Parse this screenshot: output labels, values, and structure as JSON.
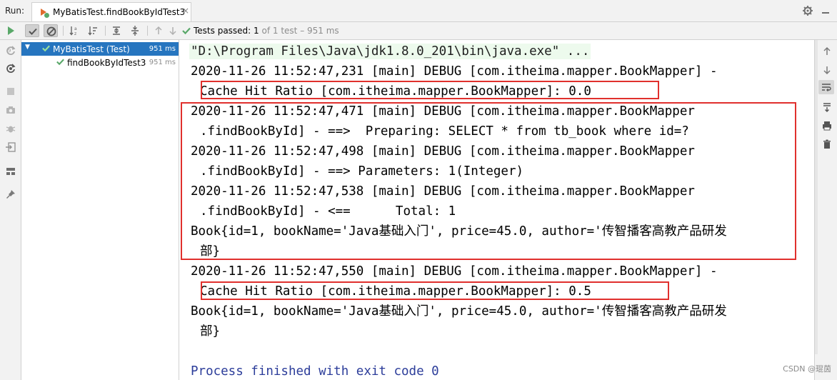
{
  "window": {
    "run_label": "Run:",
    "tab_title": "MyBatisTest.findBookByIdTest3",
    "tab_close": "×"
  },
  "toolbar": {
    "status_label": "Tests passed:",
    "status_count": "1",
    "status_detail": "of 1 test – 951 ms"
  },
  "tree": {
    "items": [
      {
        "label": "MyBatisTest (Test)",
        "time": "951 ms"
      },
      {
        "label": "findBookByIdTest3",
        "time": "951 ms"
      }
    ]
  },
  "console": {
    "command": "\"D:\\Program Files\\Java\\jdk1.8.0_201\\bin\\java.exe\" ...",
    "lines": [
      "2020-11-26 11:52:47,231 [main] DEBUG [com.itheima.mapper.BookMapper] -",
      "Cache Hit Ratio [com.itheima.mapper.BookMapper]: 0.0",
      "2020-11-26 11:52:47,471 [main] DEBUG [com.itheima.mapper.BookMapper",
      ".findBookById] - ==>  Preparing: SELECT * from tb_book where id=?",
      "2020-11-26 11:52:47,498 [main] DEBUG [com.itheima.mapper.BookMapper",
      ".findBookById] - ==> Parameters: 1(Integer)",
      "2020-11-26 11:52:47,538 [main] DEBUG [com.itheima.mapper.BookMapper",
      ".findBookById] - <==      Total: 1",
      "Book{id=1, bookName='Java基础入门', price=45.0, author='传智播客高教产品研发",
      "部}",
      "2020-11-26 11:52:47,550 [main] DEBUG [com.itheima.mapper.BookMapper] -",
      "Cache Hit Ratio [com.itheima.mapper.BookMapper]: 0.5",
      "Book{id=1, bookName='Java基础入门', price=45.0, author='传智播客高教产品研发",
      "部}"
    ],
    "exit_line": "Process finished with exit code 0"
  },
  "watermark": "CSDN @琨茵",
  "colors": {
    "accent_selection": "#2675bf",
    "pass_green": "#59a869",
    "highlight_red": "#e0302d",
    "exit_blue": "#2c3d9a"
  },
  "icons": {
    "title": [
      "test-run-icon",
      "settings-icon",
      "minimize-icon"
    ],
    "toolbar": [
      "rerun-icon",
      "show-passed-icon",
      "show-ignored-icon",
      "sort-alpha-icon",
      "sort-duration-icon",
      "expand-all-icon",
      "collapse-all-icon",
      "previous-icon",
      "next-icon",
      "pass-check-icon"
    ],
    "left_strip": [
      "rerun-failed-icon",
      "toggle-auto-test-icon",
      "stop-icon",
      "screenshot-icon",
      "debug-icon",
      "import-tests-icon",
      "layout-icon",
      "pin-icon"
    ],
    "right_strip": [
      "scroll-up-icon",
      "scroll-down-icon",
      "soft-wrap-icon",
      "scroll-to-end-icon",
      "print-icon",
      "clear-all-icon"
    ]
  }
}
